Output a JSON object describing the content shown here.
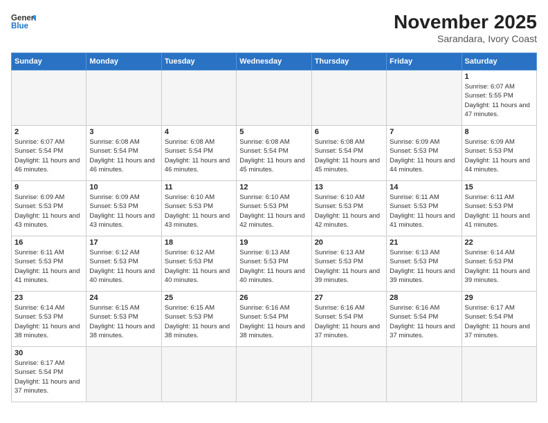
{
  "header": {
    "logo_general": "General",
    "logo_blue": "Blue",
    "month_year": "November 2025",
    "location": "Sarandara, Ivory Coast"
  },
  "weekdays": [
    "Sunday",
    "Monday",
    "Tuesday",
    "Wednesday",
    "Thursday",
    "Friday",
    "Saturday"
  ],
  "weeks": [
    [
      {
        "day": "",
        "sunrise": "",
        "sunset": "",
        "daylight": "",
        "empty": true
      },
      {
        "day": "",
        "sunrise": "",
        "sunset": "",
        "daylight": "",
        "empty": true
      },
      {
        "day": "",
        "sunrise": "",
        "sunset": "",
        "daylight": "",
        "empty": true
      },
      {
        "day": "",
        "sunrise": "",
        "sunset": "",
        "daylight": "",
        "empty": true
      },
      {
        "day": "",
        "sunrise": "",
        "sunset": "",
        "daylight": "",
        "empty": true
      },
      {
        "day": "",
        "sunrise": "",
        "sunset": "",
        "daylight": "",
        "empty": true
      },
      {
        "day": "1",
        "sunrise": "Sunrise: 6:07 AM",
        "sunset": "Sunset: 5:55 PM",
        "daylight": "Daylight: 11 hours and 47 minutes.",
        "empty": false
      }
    ],
    [
      {
        "day": "2",
        "sunrise": "Sunrise: 6:07 AM",
        "sunset": "Sunset: 5:54 PM",
        "daylight": "Daylight: 11 hours and 46 minutes.",
        "empty": false
      },
      {
        "day": "3",
        "sunrise": "Sunrise: 6:08 AM",
        "sunset": "Sunset: 5:54 PM",
        "daylight": "Daylight: 11 hours and 46 minutes.",
        "empty": false
      },
      {
        "day": "4",
        "sunrise": "Sunrise: 6:08 AM",
        "sunset": "Sunset: 5:54 PM",
        "daylight": "Daylight: 11 hours and 46 minutes.",
        "empty": false
      },
      {
        "day": "5",
        "sunrise": "Sunrise: 6:08 AM",
        "sunset": "Sunset: 5:54 PM",
        "daylight": "Daylight: 11 hours and 45 minutes.",
        "empty": false
      },
      {
        "day": "6",
        "sunrise": "Sunrise: 6:08 AM",
        "sunset": "Sunset: 5:54 PM",
        "daylight": "Daylight: 11 hours and 45 minutes.",
        "empty": false
      },
      {
        "day": "7",
        "sunrise": "Sunrise: 6:09 AM",
        "sunset": "Sunset: 5:53 PM",
        "daylight": "Daylight: 11 hours and 44 minutes.",
        "empty": false
      },
      {
        "day": "8",
        "sunrise": "Sunrise: 6:09 AM",
        "sunset": "Sunset: 5:53 PM",
        "daylight": "Daylight: 11 hours and 44 minutes.",
        "empty": false
      }
    ],
    [
      {
        "day": "9",
        "sunrise": "Sunrise: 6:09 AM",
        "sunset": "Sunset: 5:53 PM",
        "daylight": "Daylight: 11 hours and 43 minutes.",
        "empty": false
      },
      {
        "day": "10",
        "sunrise": "Sunrise: 6:09 AM",
        "sunset": "Sunset: 5:53 PM",
        "daylight": "Daylight: 11 hours and 43 minutes.",
        "empty": false
      },
      {
        "day": "11",
        "sunrise": "Sunrise: 6:10 AM",
        "sunset": "Sunset: 5:53 PM",
        "daylight": "Daylight: 11 hours and 43 minutes.",
        "empty": false
      },
      {
        "day": "12",
        "sunrise": "Sunrise: 6:10 AM",
        "sunset": "Sunset: 5:53 PM",
        "daylight": "Daylight: 11 hours and 42 minutes.",
        "empty": false
      },
      {
        "day": "13",
        "sunrise": "Sunrise: 6:10 AM",
        "sunset": "Sunset: 5:53 PM",
        "daylight": "Daylight: 11 hours and 42 minutes.",
        "empty": false
      },
      {
        "day": "14",
        "sunrise": "Sunrise: 6:11 AM",
        "sunset": "Sunset: 5:53 PM",
        "daylight": "Daylight: 11 hours and 41 minutes.",
        "empty": false
      },
      {
        "day": "15",
        "sunrise": "Sunrise: 6:11 AM",
        "sunset": "Sunset: 5:53 PM",
        "daylight": "Daylight: 11 hours and 41 minutes.",
        "empty": false
      }
    ],
    [
      {
        "day": "16",
        "sunrise": "Sunrise: 6:11 AM",
        "sunset": "Sunset: 5:53 PM",
        "daylight": "Daylight: 11 hours and 41 minutes.",
        "empty": false
      },
      {
        "day": "17",
        "sunrise": "Sunrise: 6:12 AM",
        "sunset": "Sunset: 5:53 PM",
        "daylight": "Daylight: 11 hours and 40 minutes.",
        "empty": false
      },
      {
        "day": "18",
        "sunrise": "Sunrise: 6:12 AM",
        "sunset": "Sunset: 5:53 PM",
        "daylight": "Daylight: 11 hours and 40 minutes.",
        "empty": false
      },
      {
        "day": "19",
        "sunrise": "Sunrise: 6:13 AM",
        "sunset": "Sunset: 5:53 PM",
        "daylight": "Daylight: 11 hours and 40 minutes.",
        "empty": false
      },
      {
        "day": "20",
        "sunrise": "Sunrise: 6:13 AM",
        "sunset": "Sunset: 5:53 PM",
        "daylight": "Daylight: 11 hours and 39 minutes.",
        "empty": false
      },
      {
        "day": "21",
        "sunrise": "Sunrise: 6:13 AM",
        "sunset": "Sunset: 5:53 PM",
        "daylight": "Daylight: 11 hours and 39 minutes.",
        "empty": false
      },
      {
        "day": "22",
        "sunrise": "Sunrise: 6:14 AM",
        "sunset": "Sunset: 5:53 PM",
        "daylight": "Daylight: 11 hours and 39 minutes.",
        "empty": false
      }
    ],
    [
      {
        "day": "23",
        "sunrise": "Sunrise: 6:14 AM",
        "sunset": "Sunset: 5:53 PM",
        "daylight": "Daylight: 11 hours and 38 minutes.",
        "empty": false
      },
      {
        "day": "24",
        "sunrise": "Sunrise: 6:15 AM",
        "sunset": "Sunset: 5:53 PM",
        "daylight": "Daylight: 11 hours and 38 minutes.",
        "empty": false
      },
      {
        "day": "25",
        "sunrise": "Sunrise: 6:15 AM",
        "sunset": "Sunset: 5:53 PM",
        "daylight": "Daylight: 11 hours and 38 minutes.",
        "empty": false
      },
      {
        "day": "26",
        "sunrise": "Sunrise: 6:16 AM",
        "sunset": "Sunset: 5:54 PM",
        "daylight": "Daylight: 11 hours and 38 minutes.",
        "empty": false
      },
      {
        "day": "27",
        "sunrise": "Sunrise: 6:16 AM",
        "sunset": "Sunset: 5:54 PM",
        "daylight": "Daylight: 11 hours and 37 minutes.",
        "empty": false
      },
      {
        "day": "28",
        "sunrise": "Sunrise: 6:16 AM",
        "sunset": "Sunset: 5:54 PM",
        "daylight": "Daylight: 11 hours and 37 minutes.",
        "empty": false
      },
      {
        "day": "29",
        "sunrise": "Sunrise: 6:17 AM",
        "sunset": "Sunset: 5:54 PM",
        "daylight": "Daylight: 11 hours and 37 minutes.",
        "empty": false
      }
    ],
    [
      {
        "day": "30",
        "sunrise": "Sunrise: 6:17 AM",
        "sunset": "Sunset: 5:54 PM",
        "daylight": "Daylight: 11 hours and 37 minutes.",
        "empty": false
      },
      {
        "day": "",
        "sunrise": "",
        "sunset": "",
        "daylight": "",
        "empty": true
      },
      {
        "day": "",
        "sunrise": "",
        "sunset": "",
        "daylight": "",
        "empty": true
      },
      {
        "day": "",
        "sunrise": "",
        "sunset": "",
        "daylight": "",
        "empty": true
      },
      {
        "day": "",
        "sunrise": "",
        "sunset": "",
        "daylight": "",
        "empty": true
      },
      {
        "day": "",
        "sunrise": "",
        "sunset": "",
        "daylight": "",
        "empty": true
      },
      {
        "day": "",
        "sunrise": "",
        "sunset": "",
        "daylight": "",
        "empty": true
      }
    ]
  ]
}
